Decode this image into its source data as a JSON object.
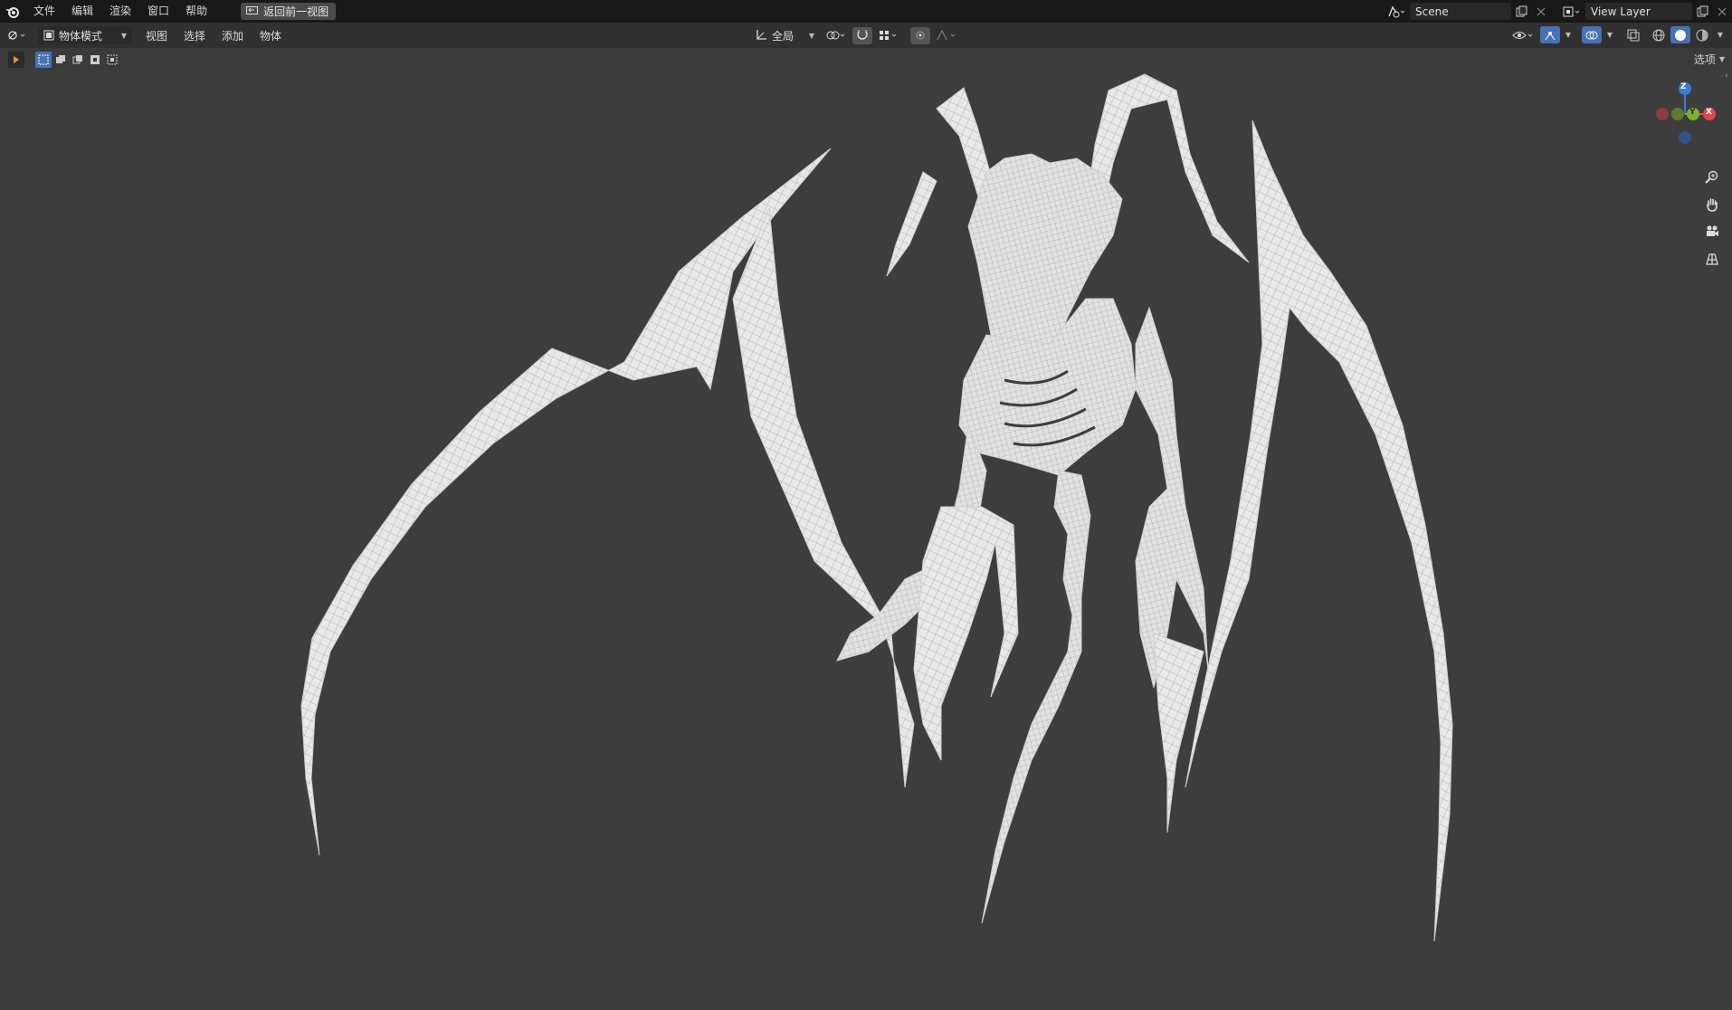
{
  "topbar": {
    "menu": [
      "文件",
      "编辑",
      "渲染",
      "窗口",
      "帮助"
    ],
    "back_button": "返回前一视图",
    "scene_name": "Scene",
    "view_layer_name": "View Layer"
  },
  "header": {
    "mode": "物体模式",
    "menus": [
      "视图",
      "选择",
      "添加",
      "物体"
    ],
    "transform_orientation": "全局",
    "options_label": "选项"
  },
  "gizmo": {
    "z": "Z",
    "x": "X",
    "y": "Y"
  },
  "colors": {
    "accent": "#4772b3",
    "x_axis": "#e2484f",
    "y_axis": "#7fb22c",
    "z_axis": "#3a7bd5",
    "mesh": "#e6e6e6",
    "wire": "#a9a9a9"
  },
  "icons": [
    "blender-logo-icon",
    "editor-type-icon",
    "object-mode-icon",
    "transform-orientation-icon",
    "pivot-icon",
    "snap-icon",
    "proportional-edit-icon",
    "zoom-icon",
    "hand-pan-icon",
    "camera-icon",
    "grid-ortho-icon",
    "visibility-icon",
    "gizmo-icon",
    "overlay-icon",
    "xray-icon",
    "shading-wireframe-icon",
    "shading-solid-icon",
    "shading-material-icon"
  ]
}
